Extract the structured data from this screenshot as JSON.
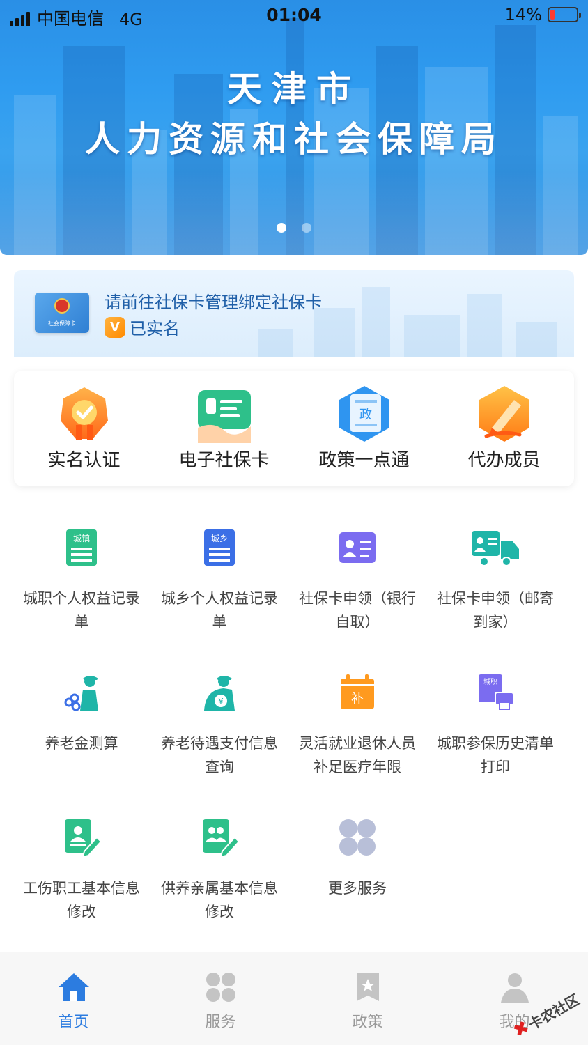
{
  "status_bar": {
    "carrier": "中国电信",
    "network": "4G",
    "time": "01:04",
    "battery": "14%"
  },
  "banner": {
    "title_line1": "天津市",
    "title_line2": "人力资源和社会保障局",
    "page_count": 2,
    "active_page": 1
  },
  "card_banner": {
    "card_text": "社会保障卡",
    "prompt": "请前往社保卡管理绑定社保卡",
    "badge": "V",
    "status": "已实名"
  },
  "quick_actions": [
    {
      "label": "实名认证",
      "icon": "verified-badge-icon"
    },
    {
      "label": "电子社保卡",
      "icon": "e-card-icon"
    },
    {
      "label": "政策一点通",
      "icon": "policy-doc-icon"
    },
    {
      "label": "代办成员",
      "icon": "pen-icon"
    }
  ],
  "services": [
    {
      "label": "城职个人权益记录单",
      "icon": "urban-record-icon",
      "icon_text": "城镇"
    },
    {
      "label": "城乡个人权益记录单",
      "icon": "rural-record-icon",
      "icon_text": "城乡"
    },
    {
      "label": "社保卡申领（银行自取）",
      "icon": "id-card-icon"
    },
    {
      "label": "社保卡申领（邮寄到家）",
      "icon": "delivery-truck-icon"
    },
    {
      "label": "养老金测算",
      "icon": "pension-calc-icon"
    },
    {
      "label": "养老待遇支付信息查询",
      "icon": "pension-payment-icon",
      "icon_text": "¥"
    },
    {
      "label": "灵活就业退休人员补足医疗年限",
      "icon": "calendar-supplement-icon",
      "icon_text": "补"
    },
    {
      "label": "城职参保历史清单打印",
      "icon": "print-history-icon",
      "icon_text": "城职"
    },
    {
      "label": "工伤职工基本信息修改",
      "icon": "edit-profile-icon"
    },
    {
      "label": "供养亲属基本信息修改",
      "icon": "edit-family-icon"
    },
    {
      "label": "更多服务",
      "icon": "more-services-icon"
    }
  ],
  "tabs": [
    {
      "label": "首页",
      "icon": "home-icon",
      "active": true
    },
    {
      "label": "服务",
      "icon": "services-icon",
      "active": false
    },
    {
      "label": "政策",
      "icon": "bookmark-icon",
      "active": false
    },
    {
      "label": "我的",
      "icon": "profile-icon",
      "active": false
    }
  ],
  "watermark": "卡农社区",
  "colors": {
    "accent": "#2c7ce0",
    "banner": "#2f9cf0",
    "green": "#2ec08a",
    "purple": "#7b6cf0",
    "orange": "#ff9a1f",
    "teal": "#1fb5a8"
  }
}
